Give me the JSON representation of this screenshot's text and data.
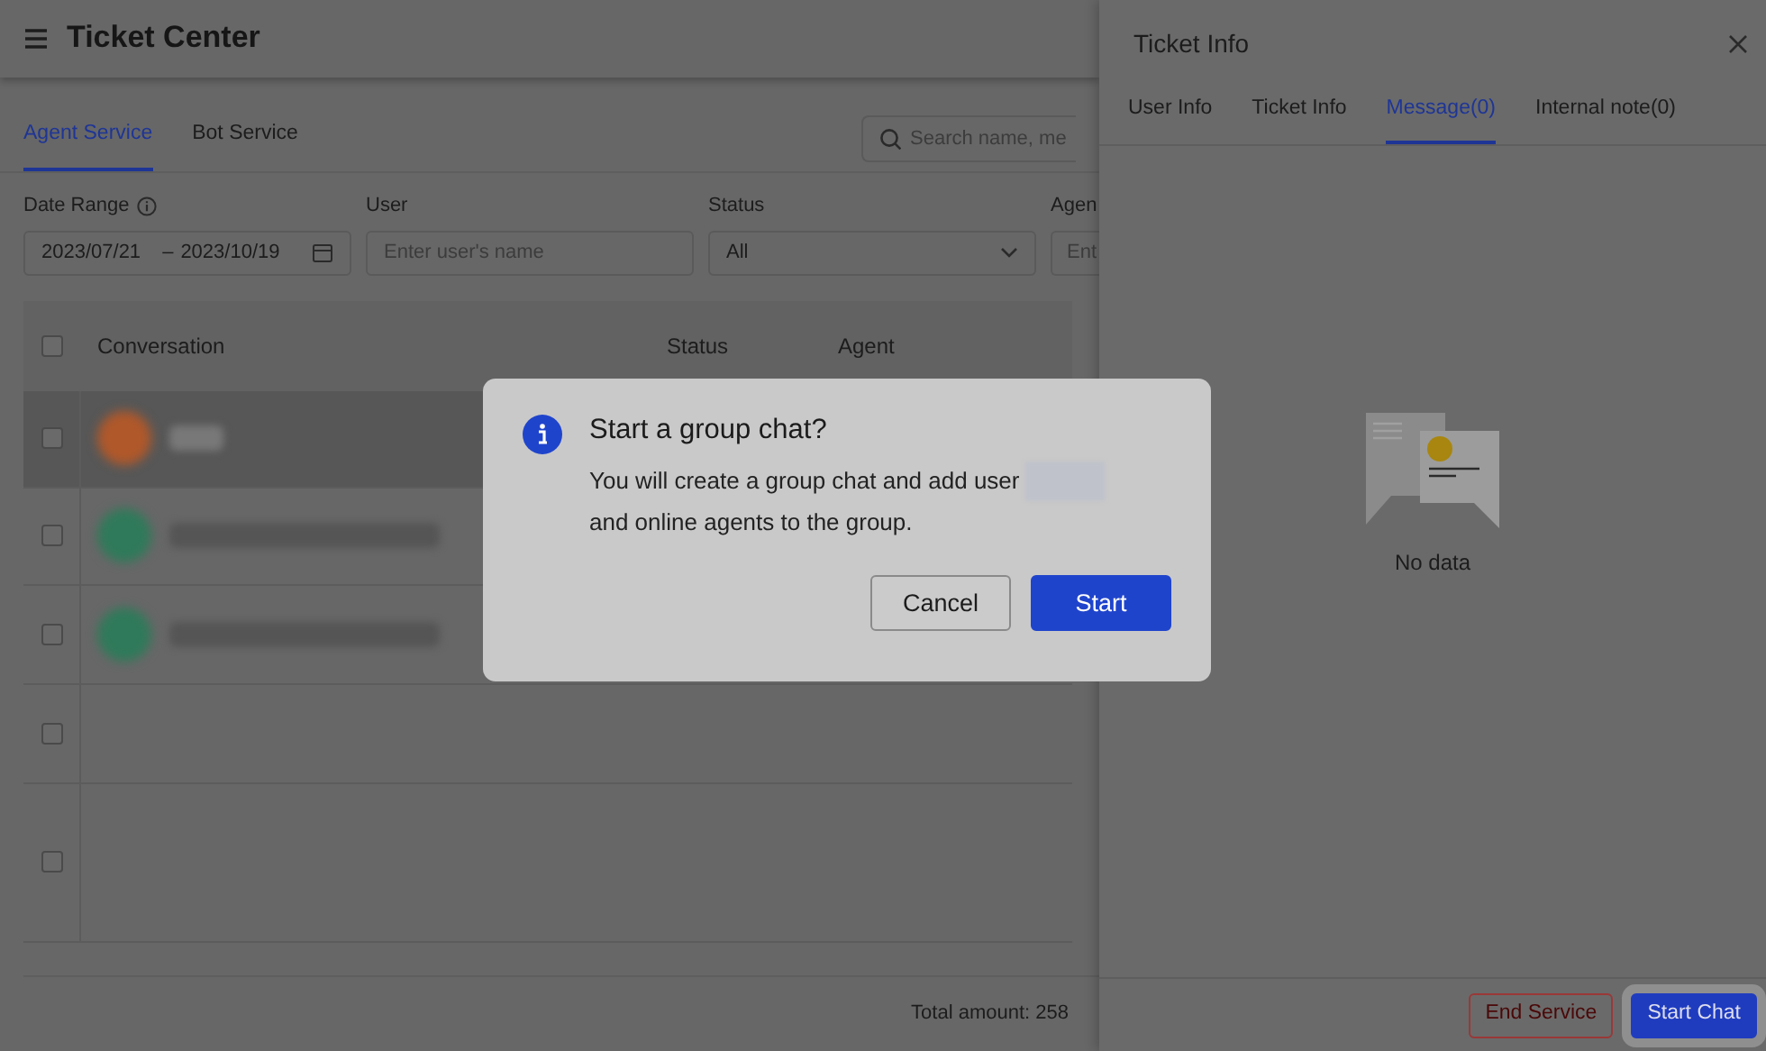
{
  "header": {
    "title": "Ticket Center"
  },
  "service_tabs": [
    {
      "label": "Agent Service",
      "selected": true
    },
    {
      "label": "Bot Service",
      "selected": false
    }
  ],
  "search": {
    "placeholder": "Search name, me"
  },
  "filters": [
    {
      "kind": "date",
      "label": "Date Range",
      "start": "2023/07/21",
      "separator": "–",
      "end": "2023/10/19"
    },
    {
      "kind": "text",
      "label": "User",
      "placeholder": "Enter user's name"
    },
    {
      "kind": "select",
      "label": "Status",
      "value": "All"
    },
    {
      "kind": "cut",
      "label": "Agen",
      "placeholder": "Ent"
    }
  ],
  "table": {
    "columns": [
      "Conversation",
      "Status",
      "Agent"
    ],
    "header_checked": false,
    "rows": [
      {
        "kind": "blurred",
        "checked": false,
        "highlighted": true,
        "color": "#b0582a"
      },
      {
        "kind": "blurred",
        "checked": false,
        "highlighted": false,
        "color": "#2f7a5a"
      },
      {
        "kind": "blurred",
        "checked": false,
        "highlighted": false,
        "color": "#2f7a5a"
      },
      {
        "kind": "empty",
        "checked": false,
        "highlighted": false
      },
      {
        "kind": "empty",
        "checked": false,
        "highlighted": false
      }
    ]
  },
  "total": "Total amount: 258",
  "drawer": {
    "title": "Ticket Info",
    "tabs": [
      {
        "label": "User Info",
        "selected": false
      },
      {
        "label": "Ticket Info",
        "selected": false
      },
      {
        "label": "Message(0)",
        "selected": true
      },
      {
        "label": "Internal note(0)",
        "selected": false
      }
    ],
    "empty_text": "No data",
    "buttons": [
      {
        "label": "End Service",
        "kind": "danger"
      },
      {
        "label": "Start Chat",
        "kind": "primary"
      }
    ]
  },
  "dialog": {
    "title": "Start a group chat?",
    "message_before": "You will create a group chat and add user",
    "message_after": "and online agents to the group.",
    "buttons": [
      {
        "label": "Cancel",
        "kind": "secondary"
      },
      {
        "label": "Start",
        "kind": "primary"
      }
    ]
  }
}
